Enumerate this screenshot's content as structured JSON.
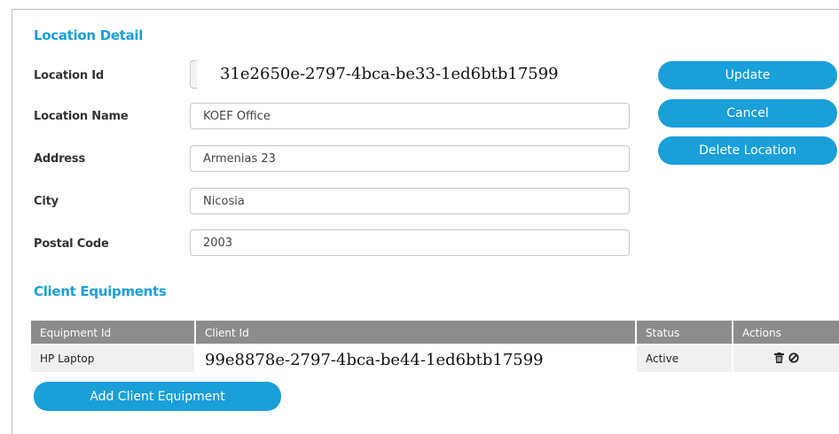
{
  "location_detail": {
    "title": "Location Detail",
    "fields": {
      "location_id": {
        "label": "Location Id",
        "value": "31e2650e-2797-4bca-be33-1ed6btb17599"
      },
      "location_name": {
        "label": "Location Name",
        "value": "KOEF Office"
      },
      "address": {
        "label": "Address",
        "value": "Armenias 23"
      },
      "city": {
        "label": "City",
        "value": "Nicosia"
      },
      "postal_code": {
        "label": "Postal Code",
        "value": "2003"
      }
    },
    "buttons": {
      "update": "Update",
      "cancel": "Cancel",
      "delete": "Delete Location"
    }
  },
  "client_equipments": {
    "title": "Client Equipments",
    "columns": [
      "Equipment Id",
      "Client Id",
      "Status",
      "Actions"
    ],
    "rows": [
      {
        "equipment_id": "HP Laptop",
        "client_id": "99e8878e-2797-4bca-be44-1ed6btb17599",
        "status": "Active",
        "actions": [
          "trash-icon",
          "disable-icon"
        ]
      }
    ],
    "add_button": "Add Client Equipment"
  },
  "colors": {
    "accent": "#1a9fd8",
    "header_gray": "#8c8c8c",
    "row_gray": "#f0f0f0"
  }
}
